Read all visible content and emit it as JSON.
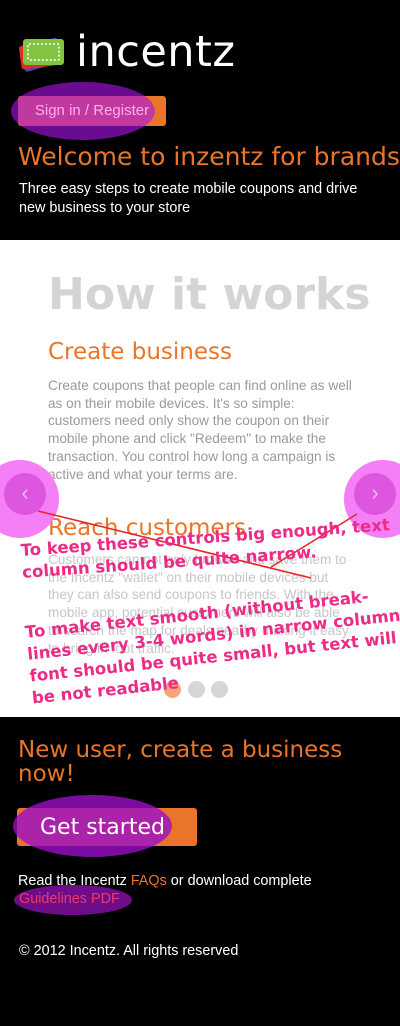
{
  "header": {
    "logo_text": "incentz",
    "signin_label": "Sign in / Register",
    "welcome": "Welcome to inzentz for brands",
    "tagline": "Three easy steps to create mobile coupons and drive new business to your store"
  },
  "how_it_works": {
    "title": "How it works",
    "steps": [
      {
        "title": "Create business",
        "text": "Create coupons that people can find online as well as on their mobile devices. It's so simple: customers need only show the coupon on their mobile phone and click \"Redeem\" to make the transaction. You control how long a campaign is active and what your terms are."
      },
      {
        "title": "Reach customers",
        "text": "Customers can not only browse and save them to the Incentz \"wallet\" on their mobile devices but they can also send coupons to friends. With the mobile app, potential customers will also be able to search the map for deals nearby making it easy to bring in foot traffic."
      }
    ],
    "prev_icon": "chevron-left-icon",
    "next_icon": "chevron-right-icon",
    "pagination_active": 1,
    "pagination_count": 3
  },
  "annotations": {
    "note1": "To keep these controls big enough, text\ncolumn should be quite narrow.",
    "note2": "To make text smooth (without break-\nlines every 3-4 words) in narrow column,\nfont should be quite small, but text will\nbe not readable"
  },
  "cta": {
    "heading": "New user, create a business now!",
    "button_label": "Get started",
    "faq_prefix": "Read the Incentz ",
    "faq_link": "FAQs",
    "faq_middle": " or download complete",
    "pdf_link": "Guidelines PDF"
  },
  "footer": {
    "copyright": "© 2012 Incentz. All rights reserved"
  },
  "colors": {
    "accent": "#e8752a",
    "background": "#000000",
    "annotation": "#ec2b86",
    "highlight": "#aa14e6"
  }
}
